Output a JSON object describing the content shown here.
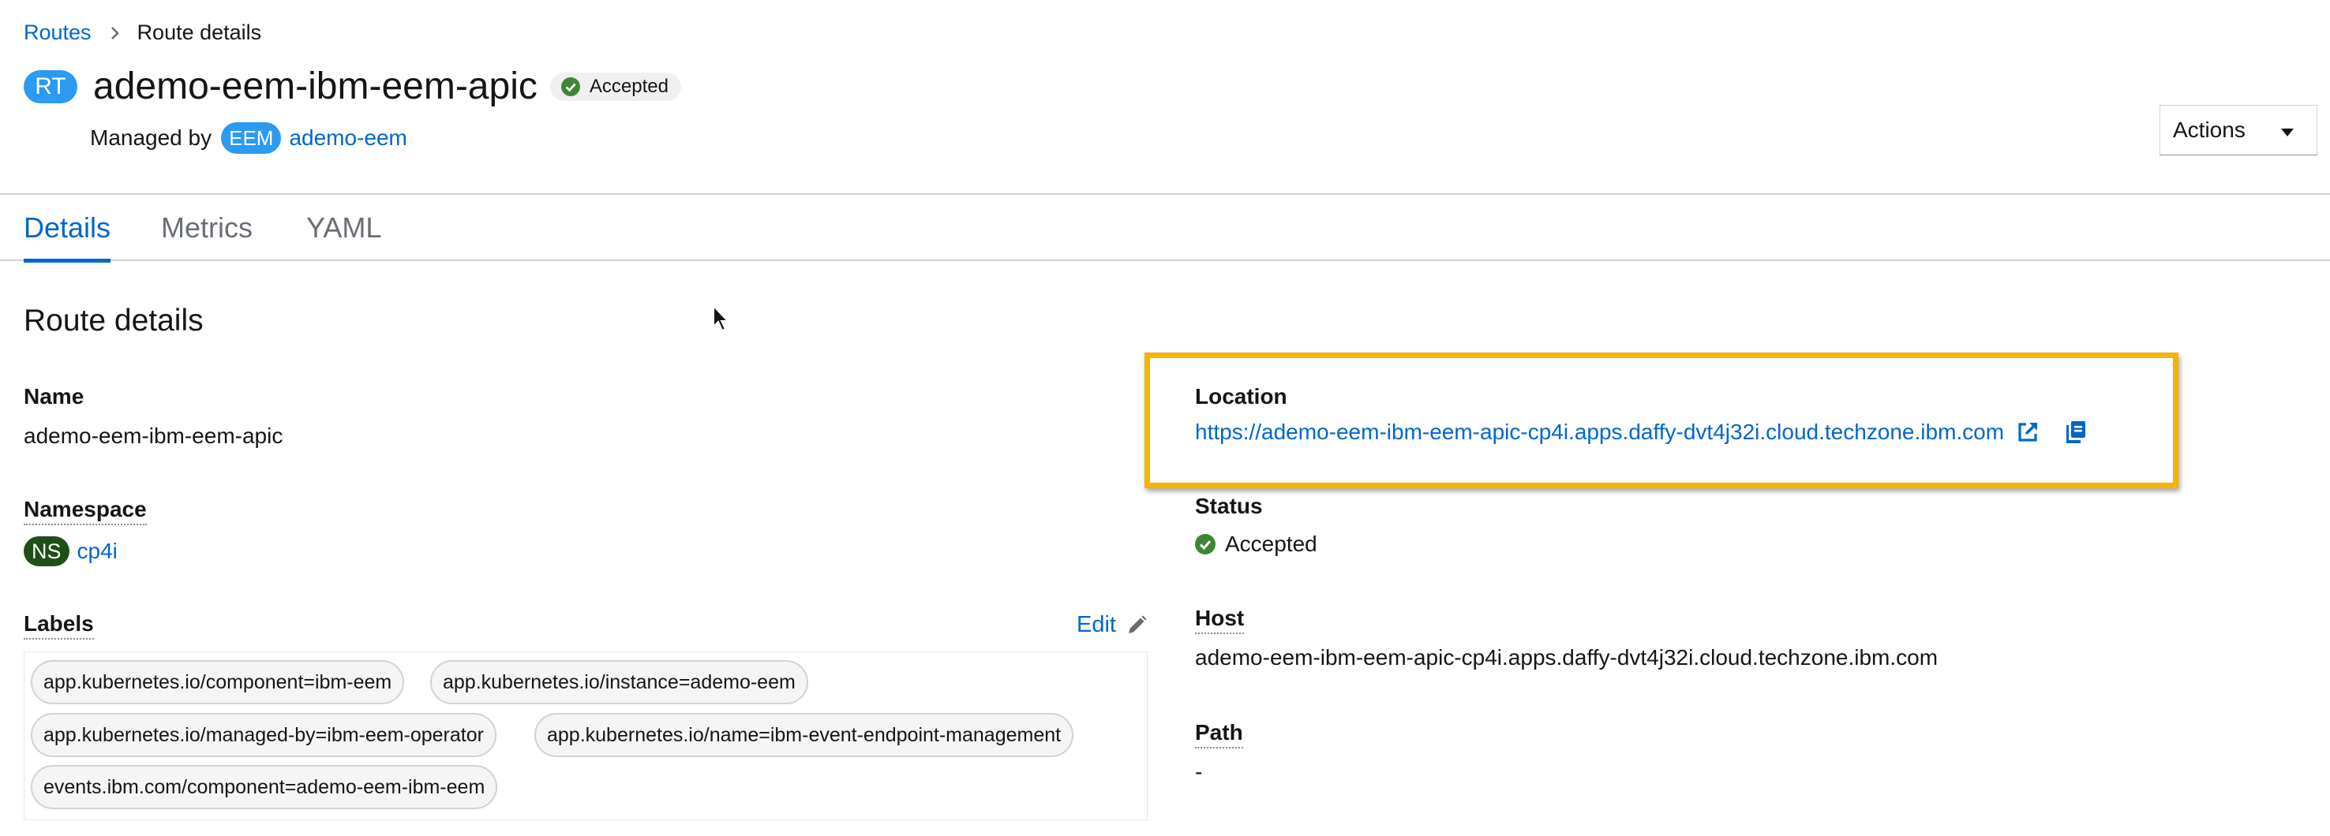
{
  "breadcrumb": {
    "parent": "Routes",
    "current": "Route details"
  },
  "header": {
    "badge": "RT",
    "title": "ademo-eem-ibm-eem-apic",
    "status": "Accepted",
    "managed_by_label": "Managed by",
    "managed_by_badge": "EEM",
    "managed_by_name": "ademo-eem"
  },
  "actions": {
    "label": "Actions"
  },
  "tabs": [
    {
      "label": "Details",
      "active": true
    },
    {
      "label": "Metrics",
      "active": false
    },
    {
      "label": "YAML",
      "active": false
    }
  ],
  "details": {
    "section_title": "Route details",
    "name_label": "Name",
    "name_value": "ademo-eem-ibm-eem-apic",
    "namespace_label": "Namespace",
    "namespace_badge": "NS",
    "namespace_value": "cp4i",
    "labels_label": "Labels",
    "edit_label": "Edit",
    "labels": [
      "app.kubernetes.io/component=ibm-eem",
      "app.kubernetes.io/instance=ademo-eem",
      "app.kubernetes.io/managed-by=ibm-eem-operator",
      "app.kubernetes.io/name=ibm-event-endpoint-management",
      "events.ibm.com/component=ademo-eem-ibm-eem"
    ],
    "location_label": "Location",
    "location_value": "https://ademo-eem-ibm-eem-apic-cp4i.apps.daffy-dvt4j32i.cloud.techzone.ibm.com",
    "status_label": "Status",
    "status_value": "Accepted",
    "host_label": "Host",
    "host_value": "ademo-eem-ibm-eem-apic-cp4i.apps.daffy-dvt4j32i.cloud.techzone.ibm.com",
    "path_label": "Path",
    "path_value": "-"
  },
  "colors": {
    "link": "#0066cc",
    "badge_blue": "#2b9af3",
    "badge_ns": "#1e4f18",
    "success": "#3e8635",
    "highlight": "#f4b400"
  },
  "icons": {
    "breadcrumb_separator": "chevron-right-icon",
    "status": "check-circle-icon",
    "dropdown": "caret-down-icon",
    "edit": "pencil-icon",
    "external": "external-link-icon",
    "copy": "copy-icon",
    "cursor": "mouse-cursor-icon"
  }
}
